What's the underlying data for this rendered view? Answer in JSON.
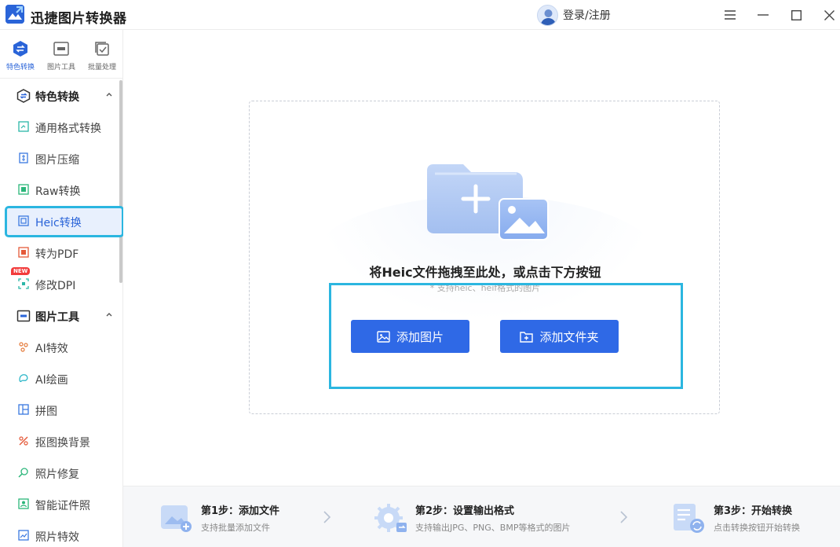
{
  "app": {
    "name": "迅捷图片转换器",
    "login_label": "登录/注册",
    "brand_color": "#2a64d8",
    "highlight_color": "#2bb6e0"
  },
  "window_controls": [
    "menu-icon",
    "minimize-icon",
    "maximize-icon",
    "close-icon"
  ],
  "sidebar": {
    "top_tabs": [
      {
        "label": "特色转换",
        "icon": "swap-icon",
        "active": true
      },
      {
        "label": "图片工具",
        "icon": "image-tool-icon",
        "active": false
      },
      {
        "label": "批量处理",
        "icon": "batch-icon",
        "active": false
      }
    ],
    "groups": [
      {
        "label": "特色转换",
        "icon": "swap-icon",
        "expanded": true,
        "items": [
          {
            "label": "通用格式转换",
            "icon": "format-convert-icon"
          },
          {
            "label": "图片压缩",
            "icon": "compress-icon"
          },
          {
            "label": "Raw转换",
            "icon": "raw-icon"
          },
          {
            "label": "Heic转换",
            "icon": "heic-icon",
            "active": true
          },
          {
            "label": "转为PDF",
            "icon": "pdf-icon"
          },
          {
            "label": "修改DPI",
            "icon": "dpi-icon",
            "badge": "NEW"
          }
        ]
      },
      {
        "label": "图片工具",
        "icon": "image-tool-icon",
        "expanded": true,
        "items": [
          {
            "label": "AI特效",
            "icon": "ai-effect-icon"
          },
          {
            "label": "AI绘画",
            "icon": "ai-paint-icon"
          },
          {
            "label": "拼图",
            "icon": "collage-icon"
          },
          {
            "label": "抠图换背景",
            "icon": "cutout-icon"
          },
          {
            "label": "照片修复",
            "icon": "repair-icon"
          },
          {
            "label": "智能证件照",
            "icon": "id-photo-icon"
          },
          {
            "label": "照片特效",
            "icon": "photo-effect-icon"
          }
        ]
      }
    ]
  },
  "drop_zone": {
    "title": "将Heic文件拖拽至此处，或点击下方按钮",
    "hint": "* 支持heic、heif格式的图片",
    "add_image_label": "添加图片",
    "add_folder_label": "添加文件夹"
  },
  "steps": [
    {
      "title": "第1步：添加文件",
      "desc": "支持批量添加文件",
      "icon": "add-file-icon"
    },
    {
      "title": "第2步：设置输出格式",
      "desc": "支持输出JPG、PNG、BMP等格式的图片",
      "icon": "settings-icon"
    },
    {
      "title": "第3步：开始转换",
      "desc": "点击转换按钮开始转换",
      "icon": "convert-icon"
    }
  ]
}
